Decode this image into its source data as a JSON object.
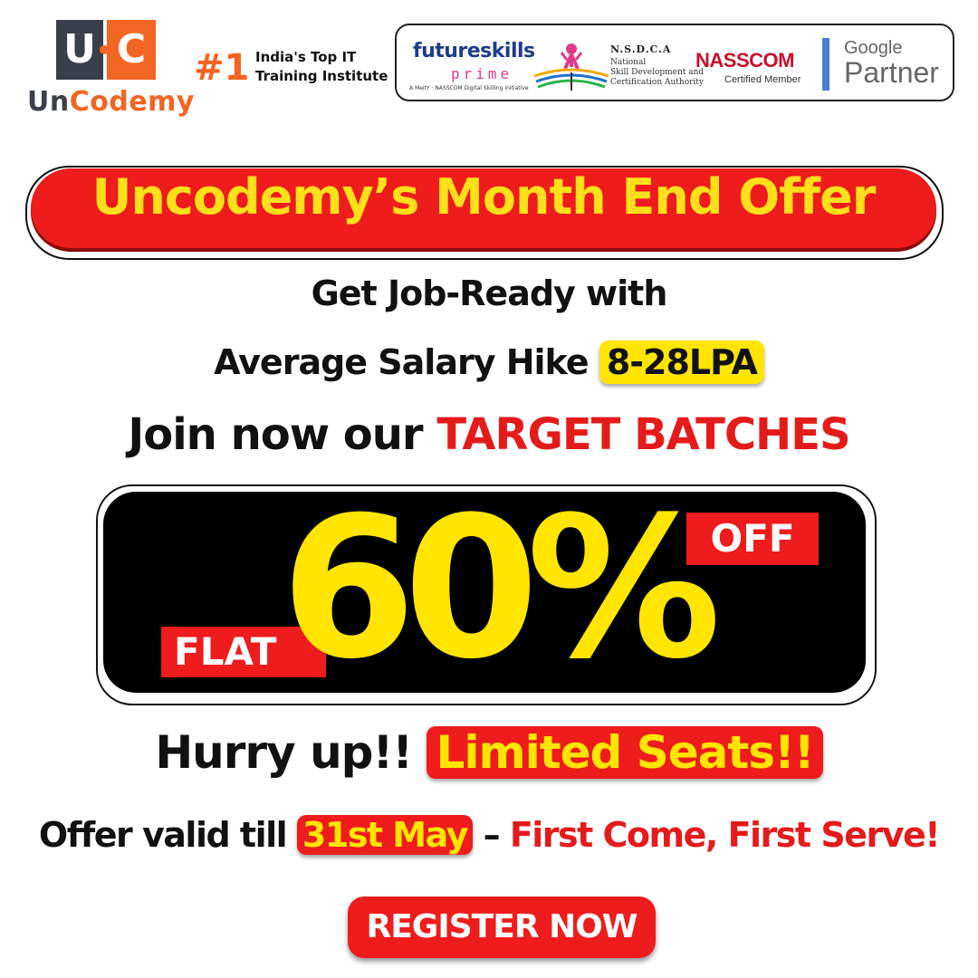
{
  "header": {
    "logo_letters": [
      "U",
      "C"
    ],
    "brand_un": "Un",
    "brand_codemy": "Codemy",
    "rank": "#1",
    "rank_text_1": "India's Top IT",
    "rank_text_2": "Training Institute"
  },
  "partners": {
    "futureskills": "futureskills",
    "futureskills_sub": "prime",
    "futureskills_tag": "A MeitY · NASSCOM Digital Skilling Initiative",
    "nsdca_title": "N.S.D.C.A",
    "nsdca_sub_1": "National",
    "nsdca_sub_2": "Skill Development and",
    "nsdca_sub_3": "Certification Authority",
    "nasscom": "NASSCOM",
    "nasscom_sub": "Certified Member",
    "google": "Google",
    "partner": "Partner"
  },
  "offer": {
    "title": "Uncodemy’s Month End Offer",
    "line1": "Get Job-Ready with",
    "line2_prefix": "Average Salary Hike",
    "line2_highlight": "8-28LPA",
    "line3_prefix": "Join now our",
    "line3_highlight": "TARGET BATCHES",
    "flat": "FLAT",
    "discount": "60%",
    "off": "OFF",
    "hurry_prefix": "Hurry up!!",
    "hurry_highlight": "Limited Seats!!",
    "valid_prefix": "Offer valid till",
    "valid_date": "31st May",
    "valid_dash": "–",
    "valid_suffix": "First Come, First Serve!",
    "register": "REGISTER NOW"
  },
  "colors": {
    "brand_orange": "#f26522",
    "brand_dark": "#3a3f4a",
    "red": "#ee1c1c",
    "yellow": "#ffe500"
  }
}
